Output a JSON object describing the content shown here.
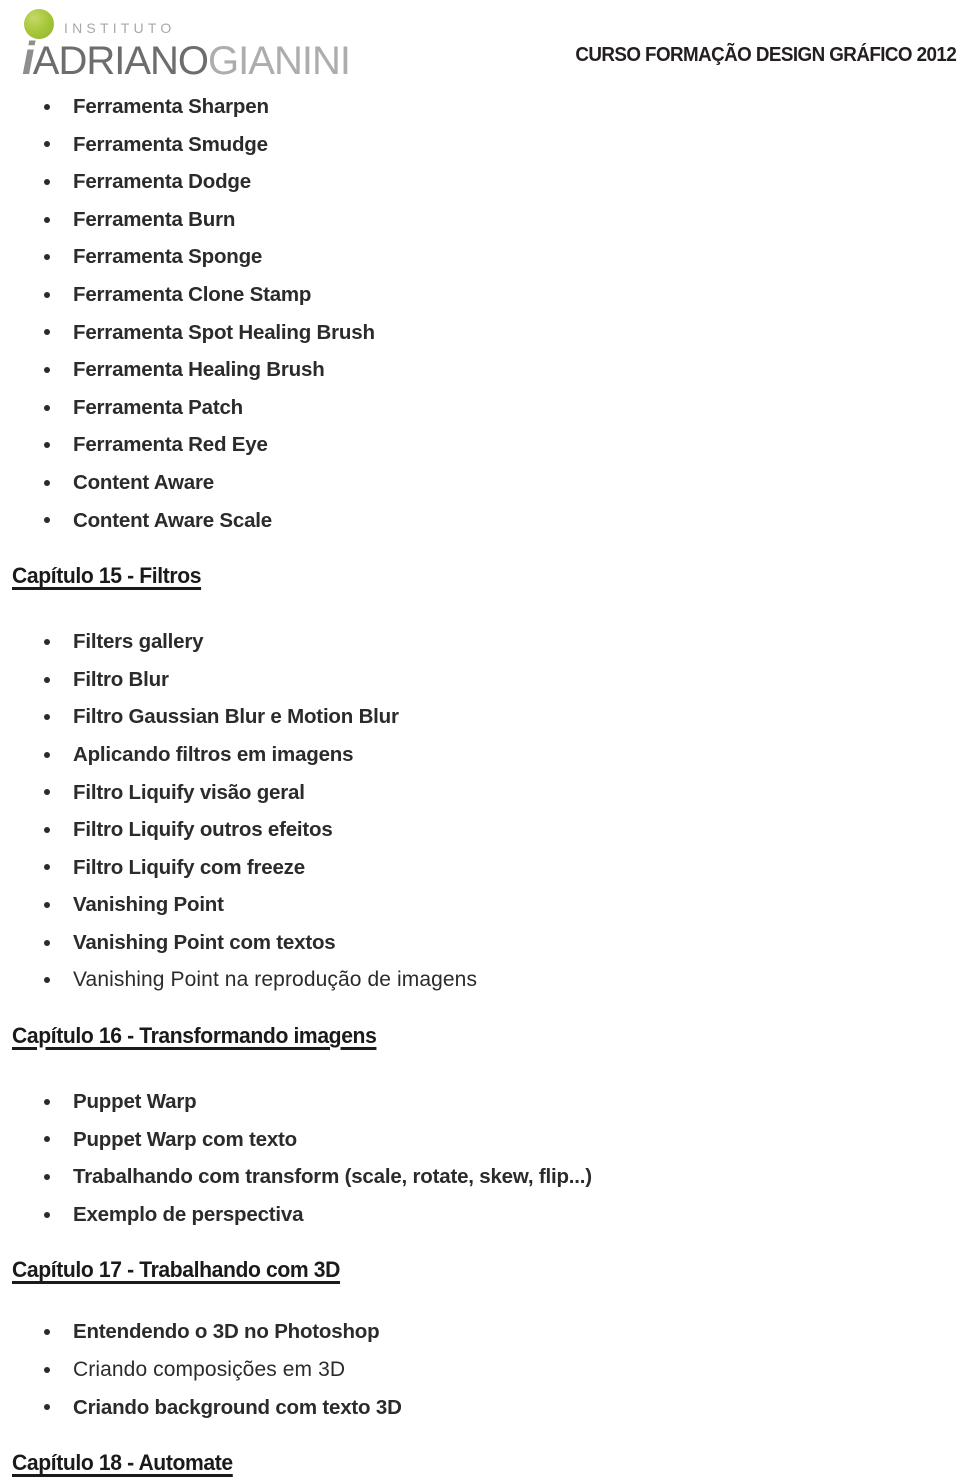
{
  "header": {
    "logo": {
      "institute_label": "INSTITUTO",
      "lead_letter": "i",
      "name_primary": "ADRIANO",
      "name_secondary": "GIANINI",
      "dot_color": "#a8c83c",
      "primary_color": "#6d6d6d",
      "secondary_color": "#adadad"
    },
    "course_title": "CURSO FORMAÇÃO DESIGN GRÁFICO 2012"
  },
  "sections": [
    {
      "id": "tools-continued",
      "heading": null,
      "items": [
        {
          "text": "Ferramenta Sharpen",
          "face": "normal"
        },
        {
          "text": "Ferramenta Smudge",
          "face": "normal"
        },
        {
          "text": "Ferramenta Dodge",
          "face": "normal"
        },
        {
          "text": "Ferramenta Burn",
          "face": "normal"
        },
        {
          "text": "Ferramenta Sponge",
          "face": "normal"
        },
        {
          "text": "Ferramenta Clone Stamp",
          "face": "normal"
        },
        {
          "text": "Ferramenta Spot Healing Brush",
          "face": "normal"
        },
        {
          "text": "Ferramenta Healing Brush",
          "face": "normal"
        },
        {
          "text": "Ferramenta Patch",
          "face": "normal"
        },
        {
          "text": "Ferramenta Red Eye",
          "face": "normal"
        },
        {
          "text": "Content Aware",
          "face": "normal"
        },
        {
          "text": "Content Aware Scale",
          "face": "normal"
        }
      ]
    },
    {
      "id": "capitulo-15",
      "heading": "Capítulo 15 - Filtros",
      "items": [
        {
          "text": "Filters gallery",
          "face": "normal"
        },
        {
          "text": "Filtro Blur",
          "face": "normal"
        },
        {
          "text": "Filtro Gaussian Blur e Motion Blur",
          "face": "normal"
        },
        {
          "text": "Aplicando filtros em imagens",
          "face": "normal"
        },
        {
          "text": "Filtro Liquify visão geral",
          "face": "normal"
        },
        {
          "text": "Filtro Liquify outros efeitos",
          "face": "normal"
        },
        {
          "text": "Filtro Liquify com freeze",
          "face": "normal"
        },
        {
          "text": "Vanishing Point",
          "face": "normal"
        },
        {
          "text": "Vanishing Point com textos",
          "face": "normal"
        },
        {
          "text": "Vanishing Point na reprodução de imagens",
          "face": "alt"
        }
      ]
    },
    {
      "id": "capitulo-16",
      "heading": "Capítulo 16 - Transformando imagens",
      "items": [
        {
          "text": "Puppet Warp",
          "face": "normal"
        },
        {
          "text": "Puppet Warp com texto",
          "face": "normal"
        },
        {
          "text": "Trabalhando com transform (scale, rotate, skew, flip...)",
          "face": "normal"
        },
        {
          "text": "Exemplo de perspectiva",
          "face": "normal"
        }
      ]
    },
    {
      "id": "capitulo-17",
      "heading": "Capítulo 17 - Trabalhando com 3D",
      "items": [
        {
          "text": "Entendendo o 3D no Photoshop",
          "face": "normal"
        },
        {
          "text": "Criando composições em 3D",
          "face": "alt"
        },
        {
          "text": "Criando background com texto 3D",
          "face": "normal"
        }
      ]
    },
    {
      "id": "capitulo-18",
      "heading": "Capítulo 18 - Automate",
      "items": []
    }
  ]
}
